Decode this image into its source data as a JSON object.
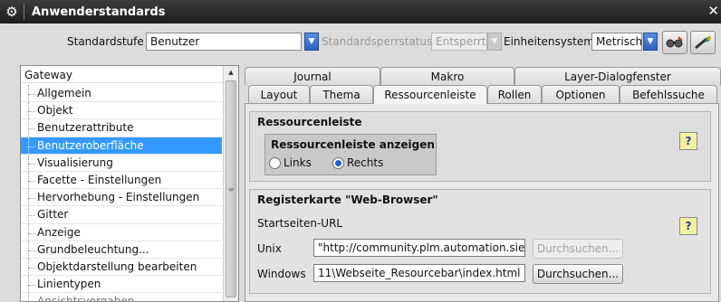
{
  "window": {
    "title": "Anwenderstandards"
  },
  "toolbar": {
    "standardstufe_label": "Standardstufe",
    "standardstufe_value": "Benutzer",
    "sperrstatus_label": "Standardsperrstatus",
    "sperrstatus_value": "Entsperrt",
    "einheiten_label": "Einheitensystem",
    "einheiten_value": "Metrisch"
  },
  "tree": {
    "root": "Gateway",
    "items": [
      "Allgemein",
      "Objekt",
      "Benutzerattribute",
      "Benutzeroberfläche",
      "Visualisierung",
      "Facette - Einstellungen",
      "Hervorhebung - Einstellungen",
      "Gitter",
      "Anzeige",
      "Grundbeleuchtung...",
      "Objektdarstellung bearbeiten",
      "Linientypen",
      "Ansichtsvorgaben"
    ],
    "selected": "Benutzeroberfläche"
  },
  "tabs": {
    "row1": [
      "Journal",
      "Makro",
      "Layer-Dialogfenster"
    ],
    "row2": [
      "Layout",
      "Thema",
      "Ressourcenleiste",
      "Rollen",
      "Optionen",
      "Befehlssuche"
    ],
    "active": "Ressourcenleiste"
  },
  "ressourcenleiste": {
    "title": "Ressourcenleiste",
    "anzeigen_title": "Ressourcenleiste anzeigen",
    "option_links": "Links",
    "option_rechts": "Rechts",
    "selected": "Rechts",
    "help": "?"
  },
  "webbrowser": {
    "title": "Registerkarte \"Web-Browser\"",
    "startseiten_label": "Startseiten-URL",
    "help": "?",
    "unix_label": "Unix",
    "unix_value": "\"http://community.plm.automation.sie",
    "windows_label": "Windows",
    "windows_value": "11\\Webseite_Resourcebar\\index.html",
    "browse_label": "Durchsuchen..."
  }
}
